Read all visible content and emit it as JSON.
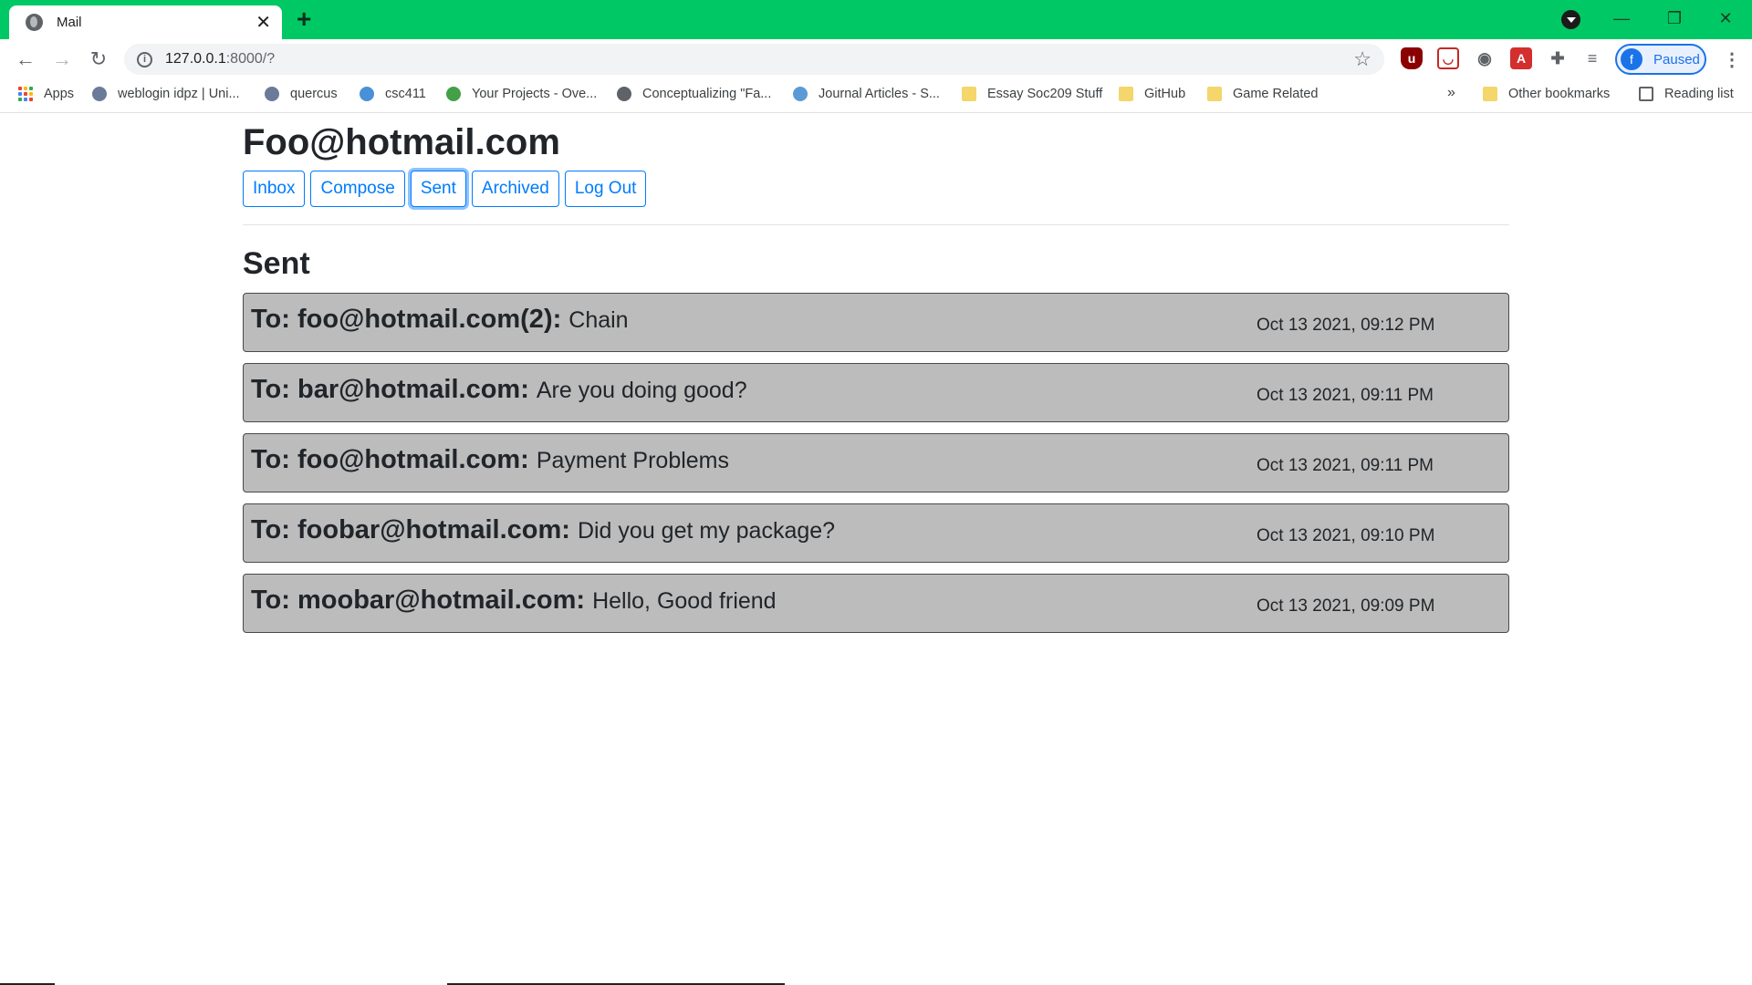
{
  "browser": {
    "tab_title": "Mail",
    "new_tab": "+",
    "url_host": "127.0.0.1",
    "url_path": ":8000/?",
    "profile_label": "Paused",
    "profile_initial": "f"
  },
  "bookmarks": {
    "items": [
      {
        "label": "Apps",
        "icon": "apps-grid-icon"
      },
      {
        "label": "weblogin idpz | Uni...",
        "icon": "globe-icon"
      },
      {
        "label": "quercus",
        "icon": "globe-icon"
      },
      {
        "label": "csc411",
        "icon": "snowflake-icon"
      },
      {
        "label": "Your Projects - Ove...",
        "icon": "leaf-icon"
      },
      {
        "label": "Conceptualizing \"Fa...",
        "icon": "globe-icon"
      },
      {
        "label": "Journal Articles - S...",
        "icon": "cloud-icon"
      },
      {
        "label": "Essay Soc209 Stuff",
        "icon": "folder-icon"
      },
      {
        "label": "GitHub",
        "icon": "folder-icon"
      },
      {
        "label": "Game Related",
        "icon": "folder-icon"
      }
    ],
    "overflow": "»",
    "other": "Other bookmarks",
    "reading_list": "Reading list"
  },
  "mail": {
    "account": "Foo@hotmail.com",
    "nav": [
      "Inbox",
      "Compose",
      "Sent",
      "Archived",
      "Log Out"
    ],
    "active_nav": "Sent",
    "section_title": "Sent",
    "emails": [
      {
        "to": "To: foo@hotmail.com(2):",
        "subject": "Chain",
        "time": "Oct 13 2021, 09:12 PM"
      },
      {
        "to": "To: bar@hotmail.com:",
        "subject": "Are you doing good?",
        "time": "Oct 13 2021, 09:11 PM"
      },
      {
        "to": "To: foo@hotmail.com:",
        "subject": "Payment Problems",
        "time": "Oct 13 2021, 09:11 PM"
      },
      {
        "to": "To: foobar@hotmail.com:",
        "subject": "Did you get my package?",
        "time": "Oct 13 2021, 09:10 PM"
      },
      {
        "to": "To: moobar@hotmail.com:",
        "subject": "Hello, Good friend",
        "time": "Oct 13 2021, 09:09 PM"
      }
    ]
  },
  "colors": {
    "titlebar": "#00c864",
    "primary": "#007bff",
    "row_bg": "#bcbcbc"
  }
}
